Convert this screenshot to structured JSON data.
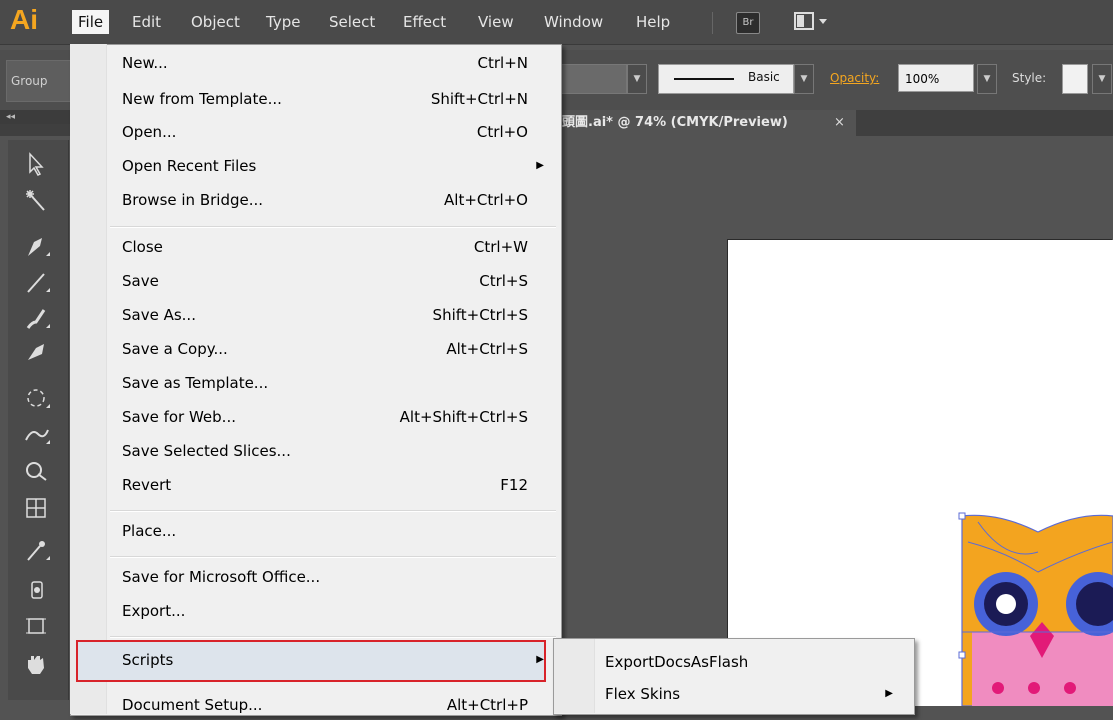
{
  "app": {
    "logo": "Ai"
  },
  "menubar": {
    "items": [
      "File",
      "Edit",
      "Object",
      "Type",
      "Select",
      "Effect",
      "View",
      "Window",
      "Help"
    ],
    "bridge_label": "Br"
  },
  "control_bar": {
    "group_label": "Group",
    "stroke_profile": "Basic",
    "opacity_label": "Opacity:",
    "opacity_value": "100%",
    "style_label": "Style:"
  },
  "document_tab": {
    "title": "頭圖.ai* @ 74% (CMYK/Preview)",
    "close": "×"
  },
  "tools": {
    "panel_collapse": "◂◂"
  },
  "file_menu": {
    "items": [
      {
        "label": "New...",
        "shortcut": "Ctrl+N"
      },
      {
        "label": "New from Template...",
        "shortcut": "Shift+Ctrl+N"
      },
      {
        "label": "Open...",
        "shortcut": "Ctrl+O"
      },
      {
        "label": "Open Recent Files",
        "shortcut": "",
        "submenu": true
      },
      {
        "label": "Browse in Bridge...",
        "shortcut": "Alt+Ctrl+O"
      },
      {
        "label": "Close",
        "shortcut": "Ctrl+W"
      },
      {
        "label": "Save",
        "shortcut": "Ctrl+S"
      },
      {
        "label": "Save As...",
        "shortcut": "Shift+Ctrl+S"
      },
      {
        "label": "Save a Copy...",
        "shortcut": "Alt+Ctrl+S"
      },
      {
        "label": "Save as Template...",
        "shortcut": ""
      },
      {
        "label": "Save for Web...",
        "shortcut": "Alt+Shift+Ctrl+S"
      },
      {
        "label": "Save Selected Slices...",
        "shortcut": ""
      },
      {
        "label": "Revert",
        "shortcut": "F12"
      },
      {
        "label": "Place...",
        "shortcut": ""
      },
      {
        "label": "Save for Microsoft Office...",
        "shortcut": ""
      },
      {
        "label": "Export...",
        "shortcut": ""
      },
      {
        "label": "Scripts",
        "shortcut": "",
        "submenu": true,
        "highlighted": true
      },
      {
        "label": "Document Setup...",
        "shortcut": "Alt+Ctrl+P"
      }
    ]
  },
  "scripts_submenu": {
    "items": [
      {
        "label": "ExportDocsAsFlash",
        "submenu": false
      },
      {
        "label": "Flex Skins",
        "submenu": true
      }
    ]
  },
  "colors": {
    "highlight_border": "#d8232a",
    "accent": "#f4a620"
  }
}
